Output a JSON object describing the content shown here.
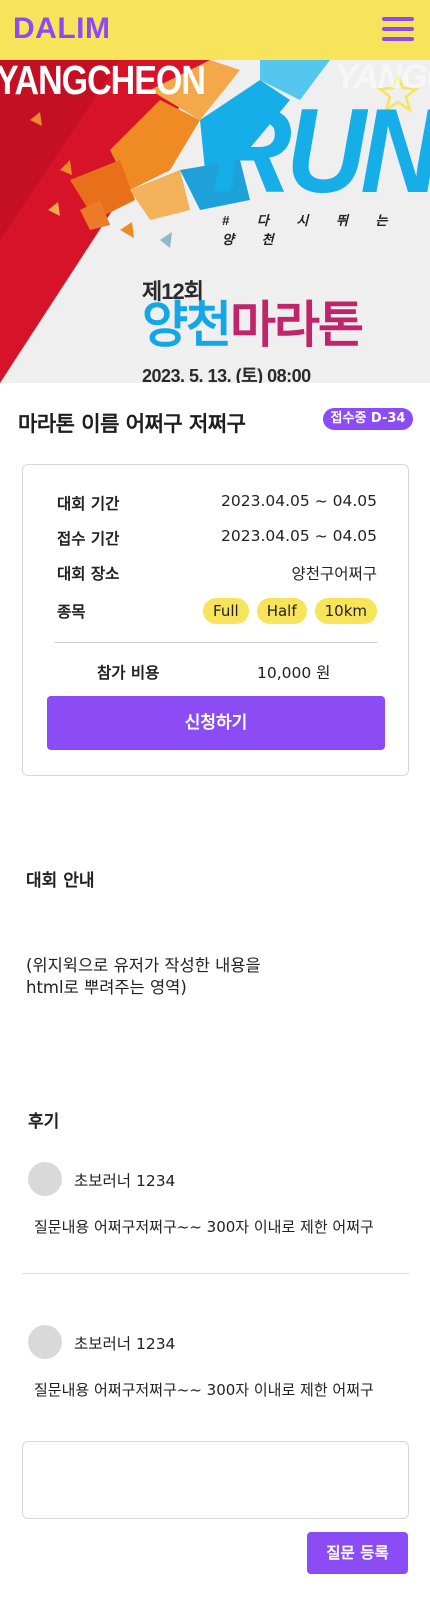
{
  "header": {
    "logo": "DALIM",
    "menu_icon": "hamburger-menu-icon"
  },
  "banner": {
    "top_left_text": "YANGCHEON",
    "top_right_text": "YANGCHEON",
    "run_text": "RUN",
    "tagline": "# 다 시  뛰 는  양 천",
    "edition": "제12회",
    "title_part1": "양천",
    "title_part2": "마라톤",
    "date": "2023. 5. 13. (토) 08:00",
    "colors": {
      "red": "#d7132a",
      "blue": "#15aee8",
      "orange": "#f08a22"
    }
  },
  "race": {
    "title": "마라톤 이름 어쩌구 저쩌구",
    "status_badge": "접수중 D-34"
  },
  "info": {
    "rows": [
      {
        "label": "대회 기간",
        "value": "2023.04.05 ~ 04.05"
      },
      {
        "label": "접수 기간",
        "value": "2023.04.05 ~ 04.05"
      },
      {
        "label": "대회 장소",
        "value": "양천구어쩌구"
      }
    ],
    "category_label": "종목",
    "categories": [
      "Full",
      "Half",
      "10km"
    ],
    "fee_label": "참가 비용",
    "fee_value": "10,000 원",
    "apply_label": "신청하기"
  },
  "guide": {
    "heading": "대회 안내",
    "body_line1": "(위지윅으로 유저가 작성한 내용을",
    "body_line2": "html로 뿌려주는 영역)"
  },
  "reviews": {
    "heading": "후기",
    "items": [
      {
        "author": "초보러너 1234",
        "text": "질문내용 어쩌구저쩌구~~ 300자 이내로 제한 어쩌구"
      },
      {
        "author": "초보러너 1234",
        "text": "질문내용 어쩌구저쩌구~~ 300자 이내로 제한 어쩌구"
      }
    ]
  },
  "question_form": {
    "input_value": "",
    "submit_label": "질문 등록"
  },
  "theme": {
    "accent": "#8b4cf6",
    "header_bg": "#f8e45a"
  }
}
